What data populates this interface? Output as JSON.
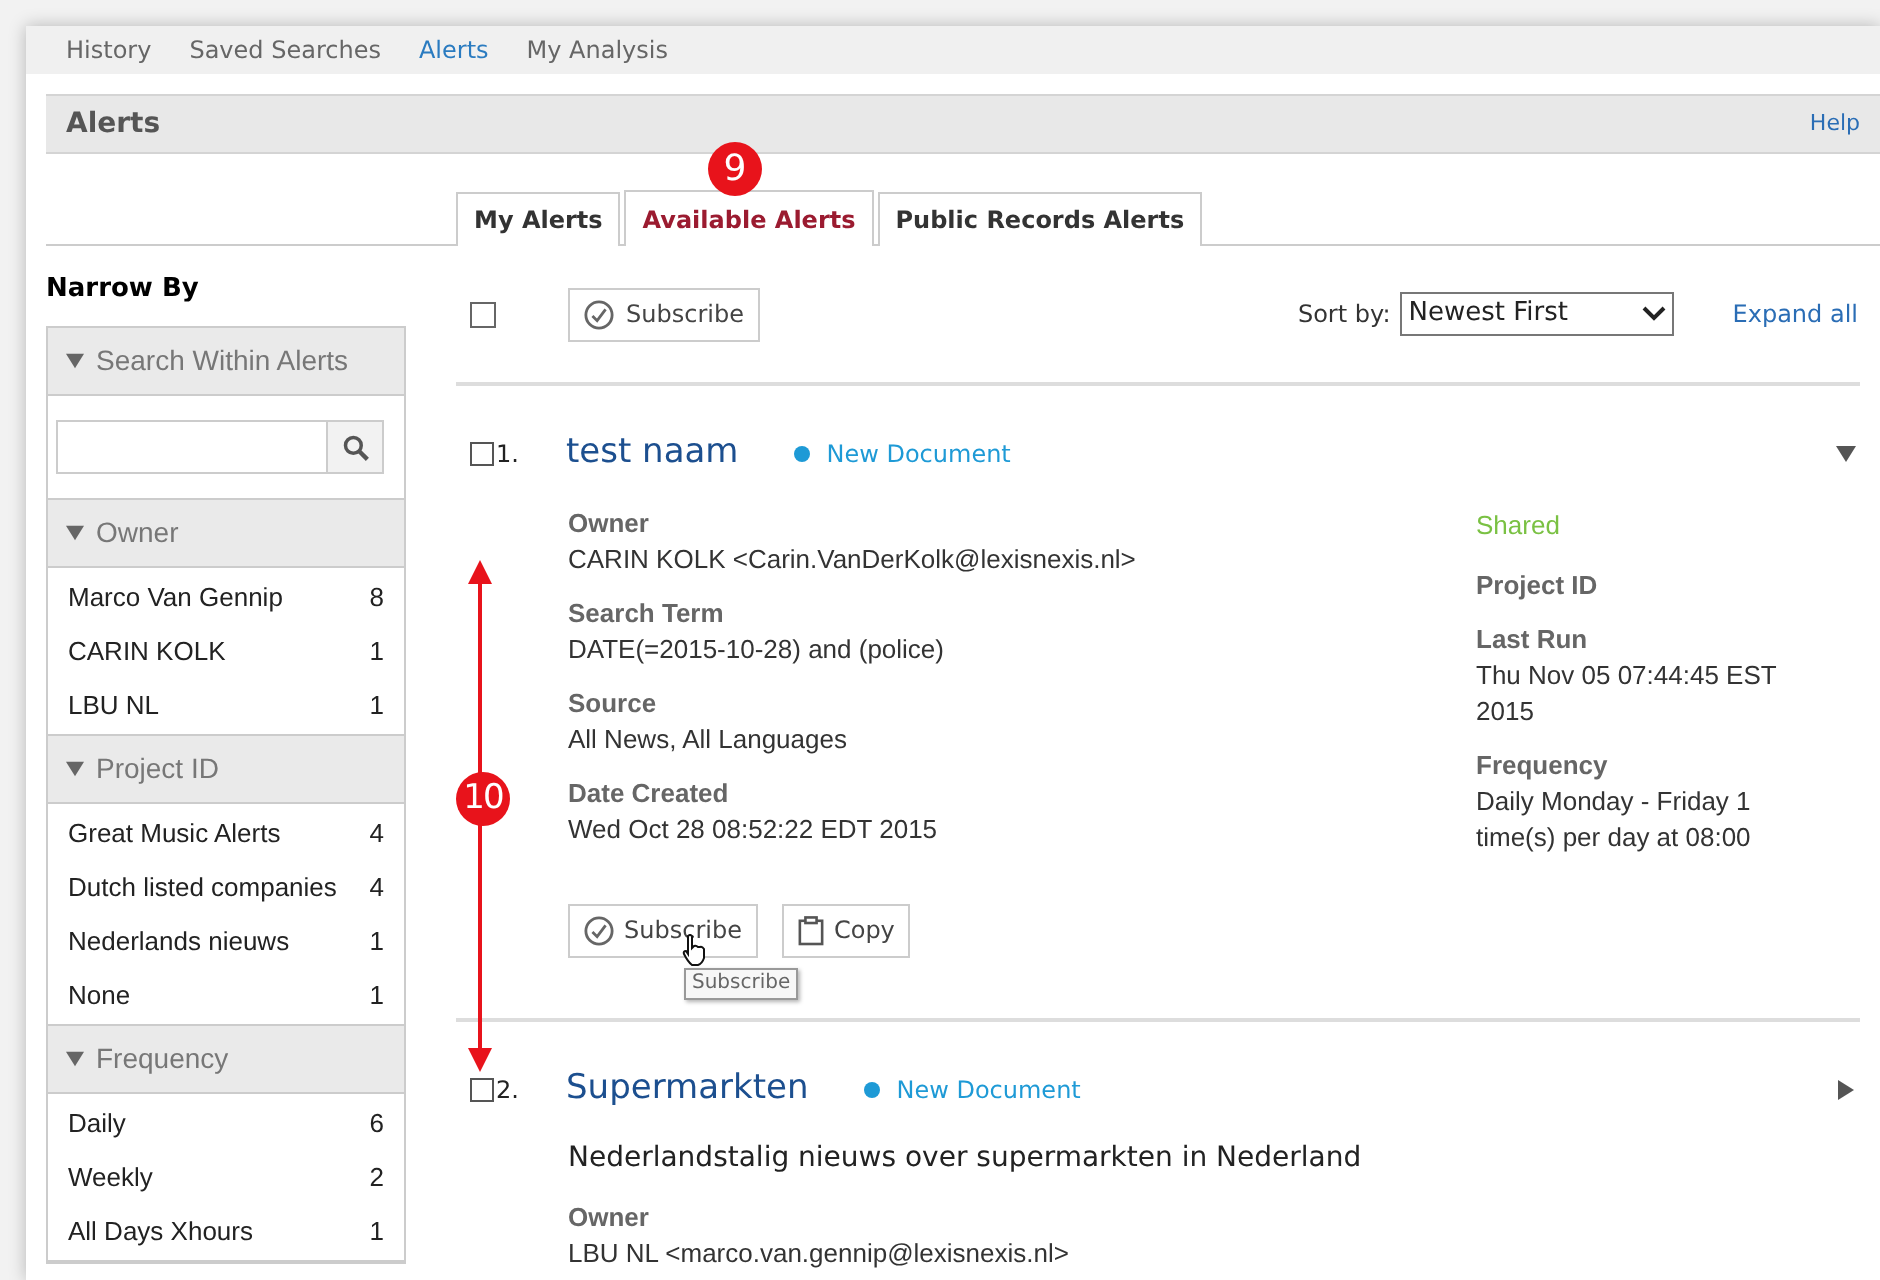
{
  "nav": [
    {
      "label": "History",
      "selected": false
    },
    {
      "label": "Saved Searches",
      "selected": false
    },
    {
      "label": "Alerts",
      "selected": true
    },
    {
      "label": "My Analysis",
      "selected": false
    }
  ],
  "header": {
    "title": "Alerts",
    "help": "Help"
  },
  "tabs": [
    {
      "label": "My Alerts",
      "selected": false
    },
    {
      "label": "Available Alerts",
      "selected": true
    },
    {
      "label": "Public Records Alerts",
      "selected": false
    }
  ],
  "callouts": [
    {
      "text": "9"
    },
    {
      "text": "10"
    }
  ],
  "sidebar": {
    "title": "Narrow By",
    "search": {
      "label": "Search Within Alerts",
      "expanded": true
    },
    "facets": [
      {
        "label": "Owner",
        "expanded": true,
        "items": [
          {
            "label": "Marco Van Gennip",
            "count": "8"
          },
          {
            "label": "CARIN  KOLK",
            "count": "1"
          },
          {
            "label": "LBU NL",
            "count": "1"
          }
        ]
      },
      {
        "label": "Project ID",
        "expanded": true,
        "items": [
          {
            "label": "Great Music Alerts",
            "count": "4"
          },
          {
            "label": "Dutch listed companies",
            "count": "4"
          },
          {
            "label": "Nederlands nieuws",
            "count": "1"
          },
          {
            "label": "None",
            "count": "1"
          }
        ]
      },
      {
        "label": "Frequency",
        "expanded": true,
        "items": [
          {
            "label": "Daily",
            "count": "6"
          },
          {
            "label": "Weekly",
            "count": "2"
          },
          {
            "label": "All Days Xhours",
            "count": "1"
          }
        ]
      }
    ]
  },
  "toolbar": {
    "select_all": {
      "checked": false
    },
    "subscribe": "Subscribe",
    "sort_label": "Sort by:",
    "sort_value": "Newest First",
    "expand_all": "Expand all"
  },
  "alerts": [
    {
      "number": "1.",
      "checked": false,
      "title": "test naam",
      "status": "New Document",
      "expanded": true,
      "left": [
        {
          "label": "Owner",
          "value": "CARIN KOLK <Carin.VanDerKolk@lexisnexis.nl>"
        },
        {
          "label": "Search Term",
          "value": "DATE(=2015-10-28) and (police)"
        },
        {
          "label": "Source",
          "value": "All News, All Languages"
        },
        {
          "label": "Date Created",
          "value": "Wed Oct 28 08:52:22 EDT 2015"
        }
      ],
      "shared": "Shared",
      "right": [
        {
          "label": "Project ID"
        },
        {
          "label": "Last Run",
          "value": "Thu Nov 05 07:44:45 EST 2015"
        },
        {
          "label": "Frequency",
          "value": "Daily Monday - Friday 1 time(s) per day at 08:00"
        }
      ],
      "buttons": [
        {
          "kind": "subscribe",
          "label": "Subscribe"
        },
        {
          "kind": "copy",
          "label": "Copy"
        }
      ],
      "tooltip": "Subscribe"
    },
    {
      "number": "2.",
      "checked": false,
      "title": "Supermarkten",
      "status": "New Document",
      "expanded": false,
      "description": "Nederlandstalig nieuws over supermarkten in Nederland",
      "left": [
        {
          "label": "Owner",
          "value": "LBU NL <marco.van.gennip@lexisnexis.nl>"
        }
      ]
    }
  ]
}
